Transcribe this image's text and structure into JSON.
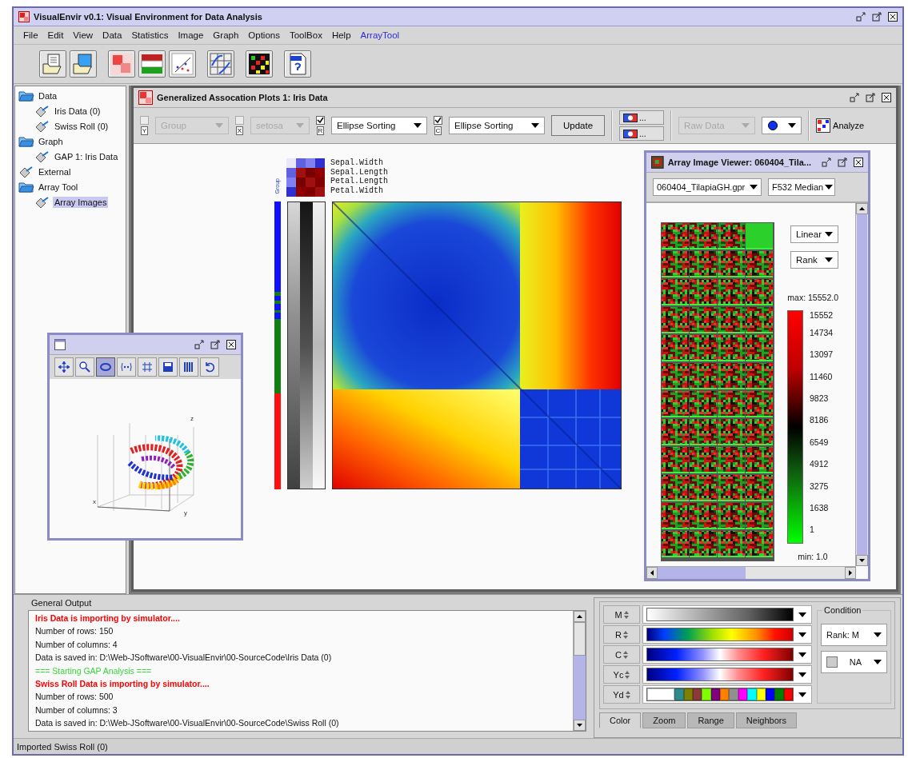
{
  "window": {
    "title": "VisualEnvir v0.1: Visual Environment for Data Analysis"
  },
  "menu": [
    {
      "label": "File",
      "highlighted": false
    },
    {
      "label": "Edit",
      "highlighted": false
    },
    {
      "label": "View",
      "highlighted": false
    },
    {
      "label": "Data",
      "highlighted": false
    },
    {
      "label": "Statistics",
      "highlighted": false
    },
    {
      "label": "Image",
      "highlighted": false
    },
    {
      "label": "Graph",
      "highlighted": false
    },
    {
      "label": "Options",
      "highlighted": false
    },
    {
      "label": "ToolBox",
      "highlighted": false
    },
    {
      "label": "Help",
      "highlighted": false
    },
    {
      "label": "ArrayTool",
      "highlighted": true
    }
  ],
  "tree": [
    {
      "label": "Data",
      "kind": "folder",
      "expanded": true,
      "selected": false,
      "children": [
        {
          "label": "Iris Data (0)",
          "kind": "item",
          "selected": false
        },
        {
          "label": "Swiss Roll (0)",
          "kind": "item",
          "selected": false
        }
      ]
    },
    {
      "label": "Graph",
      "kind": "folder",
      "expanded": true,
      "selected": false,
      "children": [
        {
          "label": "GAP 1: Iris Data",
          "kind": "item",
          "selected": false
        }
      ]
    },
    {
      "label": "External",
      "kind": "item",
      "selected": false
    },
    {
      "label": "Array Tool",
      "kind": "folder",
      "expanded": true,
      "selected": false,
      "children": [
        {
          "label": "Array Images",
          "kind": "item",
          "selected": true
        }
      ]
    }
  ],
  "gap_window": {
    "title": "Generalized Assocation Plots 1: Iris Data",
    "selectors": [
      {
        "checked": false,
        "axis": "Y",
        "value": "Group",
        "disabled": true
      },
      {
        "checked": false,
        "axis": "X",
        "value": "setosa",
        "disabled": true
      },
      {
        "checked": true,
        "axis": "R",
        "value": "Ellipse Sorting",
        "disabled": false
      },
      {
        "checked": true,
        "axis": "C",
        "value": "Ellipse Sorting",
        "disabled": false
      }
    ],
    "update_button": "Update",
    "ellipsis_buttons": [
      "...",
      "..."
    ],
    "data_select": {
      "value": "Raw Data",
      "disabled": true
    },
    "analyze_button": "Analyze",
    "heatmap": {
      "group_label": "Group",
      "variables": [
        "Sepal.Width",
        "Sepal.Length",
        "Petal.Length",
        "Petal.Width"
      ]
    }
  },
  "array_viewer": {
    "title": "Array Image Viewer: 060404_Tila...",
    "file": "060404_TilapiaGH.gpr",
    "channel": "F532 Median",
    "scale": "Linear",
    "order": "Rank",
    "max_label": "max: 15552.0",
    "min_label": "min: 1.0",
    "ticks": [
      "15552",
      "14734",
      "13097",
      "11460",
      "9823",
      "8186",
      "6549",
      "4912",
      "3275",
      "1638",
      "1"
    ]
  },
  "plot_window": {
    "tools": [
      {
        "kind": "move",
        "selected": false
      },
      {
        "kind": "zoom",
        "selected": false
      },
      {
        "kind": "rotate",
        "selected": true
      },
      {
        "kind": "coords",
        "selected": false
      },
      {
        "kind": "grid",
        "selected": false
      },
      {
        "kind": "save",
        "selected": false
      },
      {
        "kind": "bars",
        "selected": false
      },
      {
        "kind": "undo",
        "selected": false
      }
    ],
    "axes": [
      "z",
      "x",
      "y"
    ]
  },
  "output": {
    "title": "General Output",
    "lines": [
      {
        "text": "Iris Data is importing by simulator....",
        "kind": "error"
      },
      {
        "text": "Number of rows: 150",
        "kind": "normal"
      },
      {
        "text": "Number of columns: 4",
        "kind": "normal"
      },
      {
        "text": "Data is saved in: D:\\Web-JSoftware\\00-VisualEnvir\\00-SourceCode\\Iris Data (0)",
        "kind": "normal"
      },
      {
        "text": "=== Starting GAP Analysis ===",
        "kind": "info"
      },
      {
        "text": "Swiss Roll Data is importing by simulator....",
        "kind": "error"
      },
      {
        "text": "Number of rows: 500",
        "kind": "normal"
      },
      {
        "text": "Number of columns: 3",
        "kind": "normal"
      },
      {
        "text": "Data is saved in: D:\\Web-JSoftware\\00-VisualEnvir\\00-SourceCode\\Swiss Roll (0)",
        "kind": "normal"
      }
    ]
  },
  "color_panel": {
    "rows": [
      {
        "label": "M",
        "kind": "grayscale"
      },
      {
        "label": "R",
        "kind": "rainbow"
      },
      {
        "label": "C",
        "kind": "diverging"
      },
      {
        "label": "Yc",
        "kind": "diverging"
      },
      {
        "label": "Yd",
        "kind": "categorical",
        "colors": [
          {
            "color": "#ffffff"
          },
          {
            "color": "#2e8b8b"
          },
          {
            "color": "#808000"
          },
          {
            "color": "#8b3a3a"
          },
          {
            "color": "#80ff00"
          },
          {
            "color": "#800080"
          },
          {
            "color": "#ff8000"
          },
          {
            "color": "#909090"
          },
          {
            "color": "#ff00ff"
          },
          {
            "color": "#00ffff"
          },
          {
            "color": "#ffff00"
          },
          {
            "color": "#0000ff"
          },
          {
            "color": "#008000"
          },
          {
            "color": "#ff0000"
          }
        ]
      }
    ],
    "condition": {
      "title": "Condition",
      "rank": "Rank: M",
      "na": "NA"
    },
    "tabs": [
      {
        "label": "Color",
        "selected": true
      },
      {
        "label": "Zoom",
        "selected": false
      },
      {
        "label": "Range",
        "selected": false
      },
      {
        "label": "Neighbors",
        "selected": false
      }
    ]
  },
  "status_bar": "Imported Swiss Roll (0)"
}
